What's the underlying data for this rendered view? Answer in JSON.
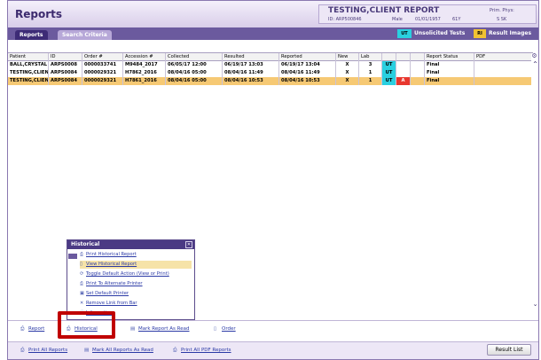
{
  "header": {
    "title": "Reports",
    "patient": {
      "name": "TESTING,CLIENT REPORT",
      "id": "ID: ARP500846",
      "sex": "Male",
      "dob": "01/01/1957",
      "age": "61Y",
      "phys_label": "Prim. Phys:",
      "phys_value": "S SK"
    }
  },
  "tabs": [
    "Reports",
    "Search Criteria"
  ],
  "legend": {
    "ut": "UT",
    "unsolicited": "Unsolicited Tests",
    "ri": "RI",
    "result_images": "Result Images"
  },
  "grid": {
    "columns": [
      "Patient",
      "ID",
      "Order #",
      "Accession #",
      "Collected",
      "Resulted",
      "Reported",
      "New",
      "Lab",
      "",
      "",
      "",
      "Report Status",
      "PDF"
    ],
    "rows": [
      [
        "BALL,CRYSTAL",
        "ARPS0008",
        "0000033741",
        "M9484_2017",
        "06/05/17 12:00",
        "06/19/17 13:03",
        "06/19/17 13:04",
        "X",
        "3",
        "UT",
        "",
        "",
        "Final",
        ""
      ],
      [
        "TESTING,CLIENT",
        "ARPS0084",
        "0000029321",
        "H7862_2016",
        "08/04/16 05:00",
        "08/04/16 11:49",
        "08/04/16 11:49",
        "X",
        "1",
        "UT",
        "",
        "",
        "Final",
        ""
      ],
      [
        "TESTING,CLIENT",
        "ARPS0084",
        "0000029321",
        "H7861_2016",
        "08/04/16 05:00",
        "08/04/16 10:53",
        "08/04/16 10:53",
        "X",
        "1",
        "UT",
        "A",
        "",
        "Final",
        ""
      ]
    ]
  },
  "popup": {
    "title": "Historical",
    "items": [
      {
        "label": "Print Historical Report",
        "icon": "printer-icon",
        "glyph": "⎙"
      },
      {
        "label": "View Historical Report",
        "icon": "document-icon",
        "glyph": "▯"
      },
      {
        "label": "Toggle Default Action (View or Print)",
        "icon": "toggle-icon",
        "glyph": "⟳"
      },
      {
        "label": "Print To Alternate Printer",
        "icon": "printer-icon",
        "glyph": "⎙"
      },
      {
        "label": "Set Default Printer",
        "icon": "printer-check-icon",
        "glyph": "▣"
      },
      {
        "label": "Remove Link from Bar",
        "icon": "remove-icon",
        "glyph": "✕"
      },
      {
        "label": "Information",
        "icon": "info-icon",
        "glyph": "ⓘ"
      }
    ]
  },
  "bottom_bar": {
    "report": "Report",
    "historical": "Historical",
    "mark_read": "Mark Report As Read",
    "order": "Order"
  },
  "footer": {
    "print_all": "Print All Reports",
    "mark_all": "Mark All Reports As Read",
    "print_pdf": "Print All PDF Reports",
    "result_list": "Result List"
  },
  "colors": {
    "accent": "#6b5a9e",
    "selected_row": "#f6c974",
    "ut": "#2ad0e0",
    "abnormal": "#e8372e",
    "highlight": "#c00000"
  }
}
